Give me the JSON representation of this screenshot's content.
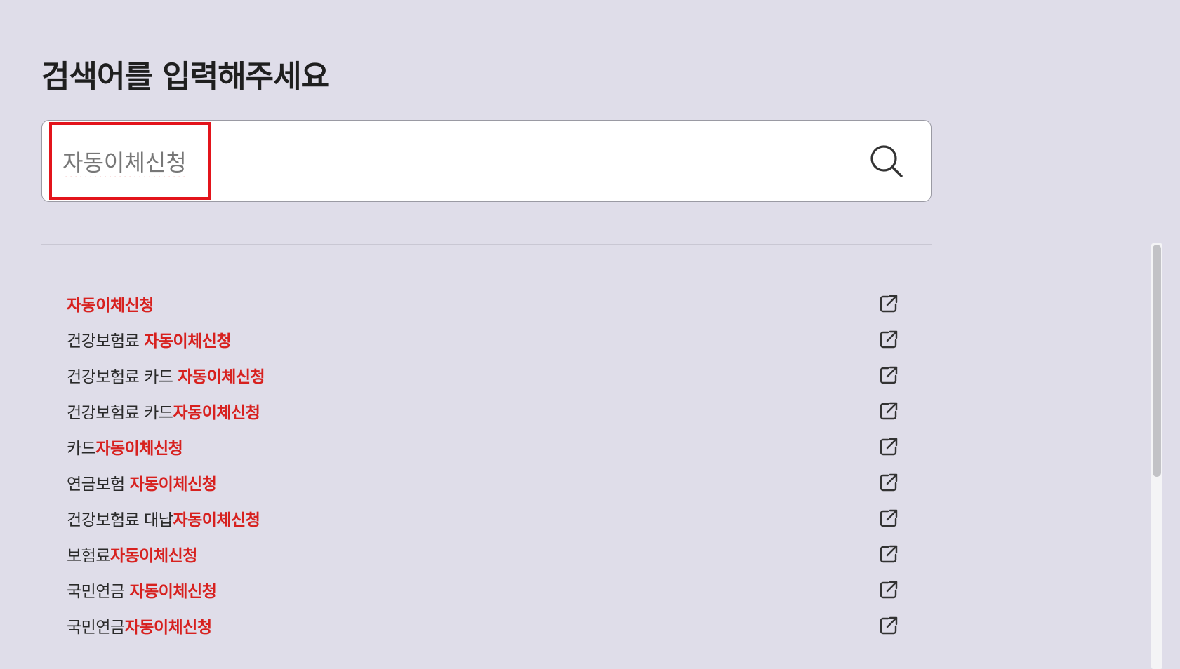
{
  "page": {
    "title": "검색어를 입력해주세요"
  },
  "search": {
    "value": "자동이체신청",
    "icon": "search-icon"
  },
  "results": [
    {
      "prefix": "",
      "highlight": "자동이체신청"
    },
    {
      "prefix": "건강보험료 ",
      "highlight": "자동이체신청"
    },
    {
      "prefix": "건강보험료 카드 ",
      "highlight": "자동이체신청"
    },
    {
      "prefix": "건강보험료 카드",
      "highlight": "자동이체신청"
    },
    {
      "prefix": "카드",
      "highlight": "자동이체신청"
    },
    {
      "prefix": "연금보험 ",
      "highlight": "자동이체신청"
    },
    {
      "prefix": "건강보험료 대납",
      "highlight": "자동이체신청"
    },
    {
      "prefix": "보험료",
      "highlight": "자동이체신청"
    },
    {
      "prefix": "국민연금 ",
      "highlight": "자동이체신청"
    },
    {
      "prefix": "국민연금",
      "highlight": "자동이체신청"
    }
  ],
  "colors": {
    "background": "#dfdde9",
    "highlight_text": "#d7211f",
    "annotation_box": "#e3141b"
  },
  "icons": {
    "result_link": "external-link-icon"
  }
}
